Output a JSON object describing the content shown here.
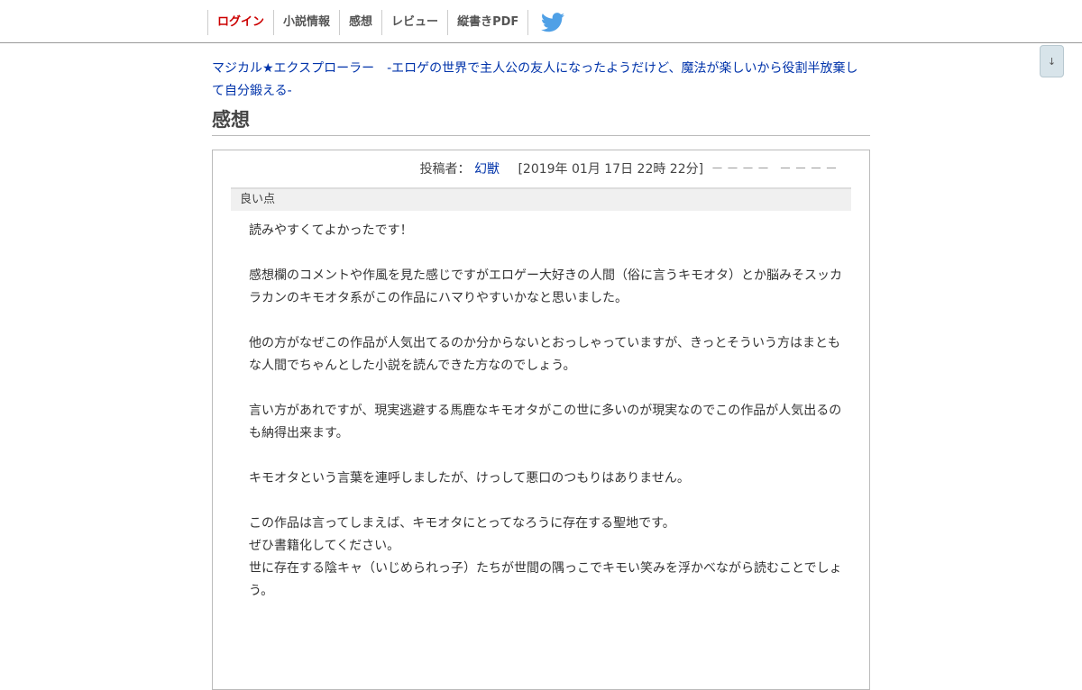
{
  "nav": {
    "items": [
      "ログイン",
      "小説情報",
      "感想",
      "レビュー",
      "縦書きPDF"
    ],
    "twitter_icon": "twitter-bird-icon",
    "twitter_color": "#4fa0e6"
  },
  "scroll_button": {
    "label": "↓"
  },
  "novel": {
    "title": "マジカル★エクスプローラー　-エロゲの世界で主人公の友人になったようだけど、魔法が楽しいから役割半放棄して自分鍛える-"
  },
  "page": {
    "title": "感想"
  },
  "review": {
    "author_label": "投稿者：",
    "author": "幻獣",
    "date": "[2019年 01月 17日 22時 22分]",
    "rating": "－－－－ －－－－",
    "section_label": "良い点",
    "lines": [
      "読みやすくてよかったです！",
      "",
      "感想欄のコメントや作風を見た感じですがエロゲー大好きの人間（俗に言うキモオタ）とか脳みそスッカラカンのキモオタ系がこの作品にハマりやすいかなと思いました。",
      "",
      "他の方がなぜこの作品が人気出てるのか分からないとおっしゃっていますが、きっとそういう方はまともな人間でちゃんとした小説を読んできた方なのでしょう。",
      "",
      "言い方があれですが、現実逃避する馬鹿なキモオタがこの世に多いのが現実なのでこの作品が人気出るのも納得出来ます。",
      "",
      "キモオタという言葉を連呼しましたが、けっして悪口のつもりはありません。",
      "",
      "この作品は言ってしまえば、キモオタにとってなろうに存在する聖地です。",
      "ぜひ書籍化してください。",
      "世に存在する陰キャ（いじめられっ子）たちが世間の隅っこでキモい笑みを浮かべながら読むことでしょう。"
    ]
  }
}
